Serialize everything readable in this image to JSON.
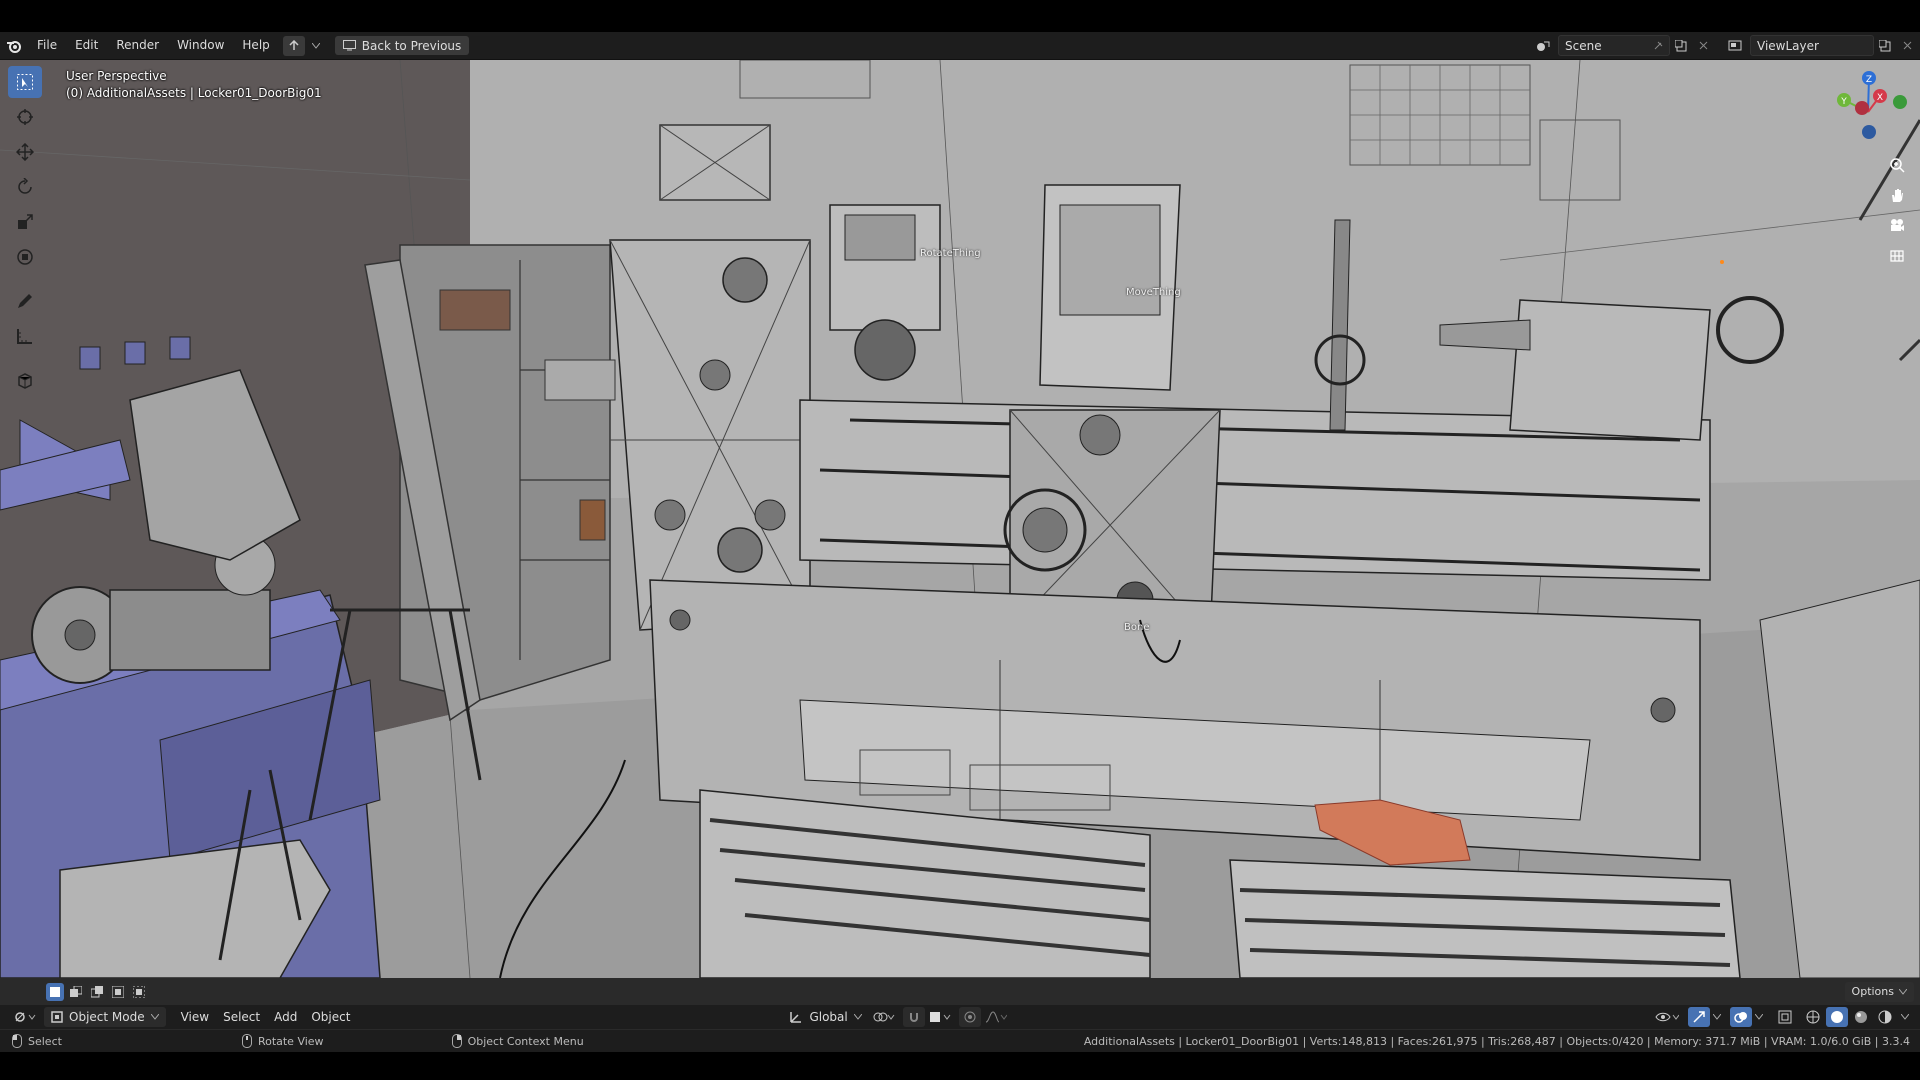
{
  "topbar": {
    "menus": [
      "File",
      "Edit",
      "Render",
      "Window",
      "Help"
    ],
    "back_button": "Back to Previous",
    "scene_field": "Scene",
    "viewlayer_field": "ViewLayer"
  },
  "viewport": {
    "perspective": "User Perspective",
    "active_object": "(0) AdditionalAssets | Locker01_DoorBig01",
    "object_labels": {
      "rotate": "RotateThing",
      "move": "MoveThing",
      "bone": "Bone"
    },
    "gizmo_axes": [
      "Z",
      "Y",
      "X"
    ],
    "options_label": "Options"
  },
  "header": {
    "mode": "Object Mode",
    "menus": [
      "View",
      "Select",
      "Add",
      "Object"
    ],
    "transform_orientation": "Global"
  },
  "statusbar": {
    "select": "Select",
    "rotate": "Rotate View",
    "context": "Object Context Menu",
    "stats": "AdditionalAssets | Locker01_DoorBig01 | Verts:148,813 | Faces:261,975 | Tris:268,487 | Objects:0/420 | Memory: 371.7 MiB | VRAM: 1.0/6.0 GiB | 3.3.4"
  }
}
